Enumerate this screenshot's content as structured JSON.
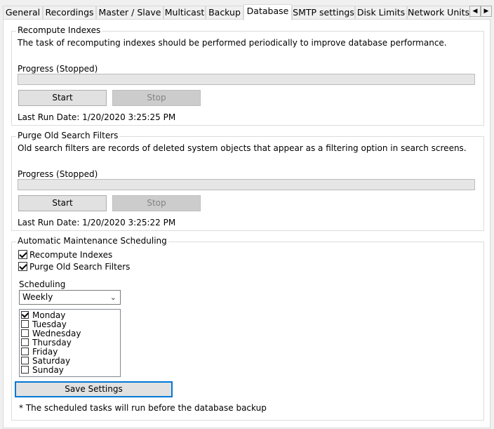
{
  "tabs": [
    {
      "label": "General",
      "active": false
    },
    {
      "label": "Recordings",
      "active": false
    },
    {
      "label": "Master / Slave",
      "active": false
    },
    {
      "label": "Multicast",
      "active": false
    },
    {
      "label": "Backup",
      "active": false
    },
    {
      "label": "Database",
      "active": true
    },
    {
      "label": "SMTP settings",
      "active": false
    },
    {
      "label": "Disk Limits",
      "active": false
    },
    {
      "label": "Network Units",
      "active": false
    }
  ],
  "scroll": {
    "left": "◀",
    "right": "▶"
  },
  "recompute": {
    "title": "Recompute Indexes",
    "description": "The task of recomputing indexes should be performed periodically to improve database performance.",
    "progress_label": "Progress (Stopped)",
    "progress_value": 0,
    "start_label": "Start",
    "stop_label": "Stop",
    "last_run": "Last Run Date: 1/20/2020 3:25:25 PM"
  },
  "purge": {
    "title": "Purge Old Search Filters",
    "description": "Old search filters are records of deleted system objects that appear as a filtering option in search screens.",
    "progress_label": "Progress (Stopped)",
    "progress_value": 0,
    "start_label": "Start",
    "stop_label": "Stop",
    "last_run": "Last Run Date: 1/20/2020 3:25:22 PM"
  },
  "maintenance": {
    "title": "Automatic Maintenance Scheduling",
    "recompute_check": {
      "label": "Recompute Indexes",
      "checked": true
    },
    "purge_check": {
      "label": "Purge Old Search Filters",
      "checked": true
    },
    "scheduling_label": "Scheduling",
    "scheduling_value": "Weekly",
    "days": [
      {
        "label": "Monday",
        "checked": true
      },
      {
        "label": "Tuesday",
        "checked": false
      },
      {
        "label": "Wednesday",
        "checked": false
      },
      {
        "label": "Thursday",
        "checked": false
      },
      {
        "label": "Friday",
        "checked": false
      },
      {
        "label": "Saturday",
        "checked": false
      },
      {
        "label": "Sunday",
        "checked": false
      }
    ],
    "save_label": "Save Settings",
    "footnote": "* The scheduled tasks will run before the database backup"
  },
  "colors": {
    "accent": "#0078d7",
    "progress_fill": "#06b025"
  }
}
